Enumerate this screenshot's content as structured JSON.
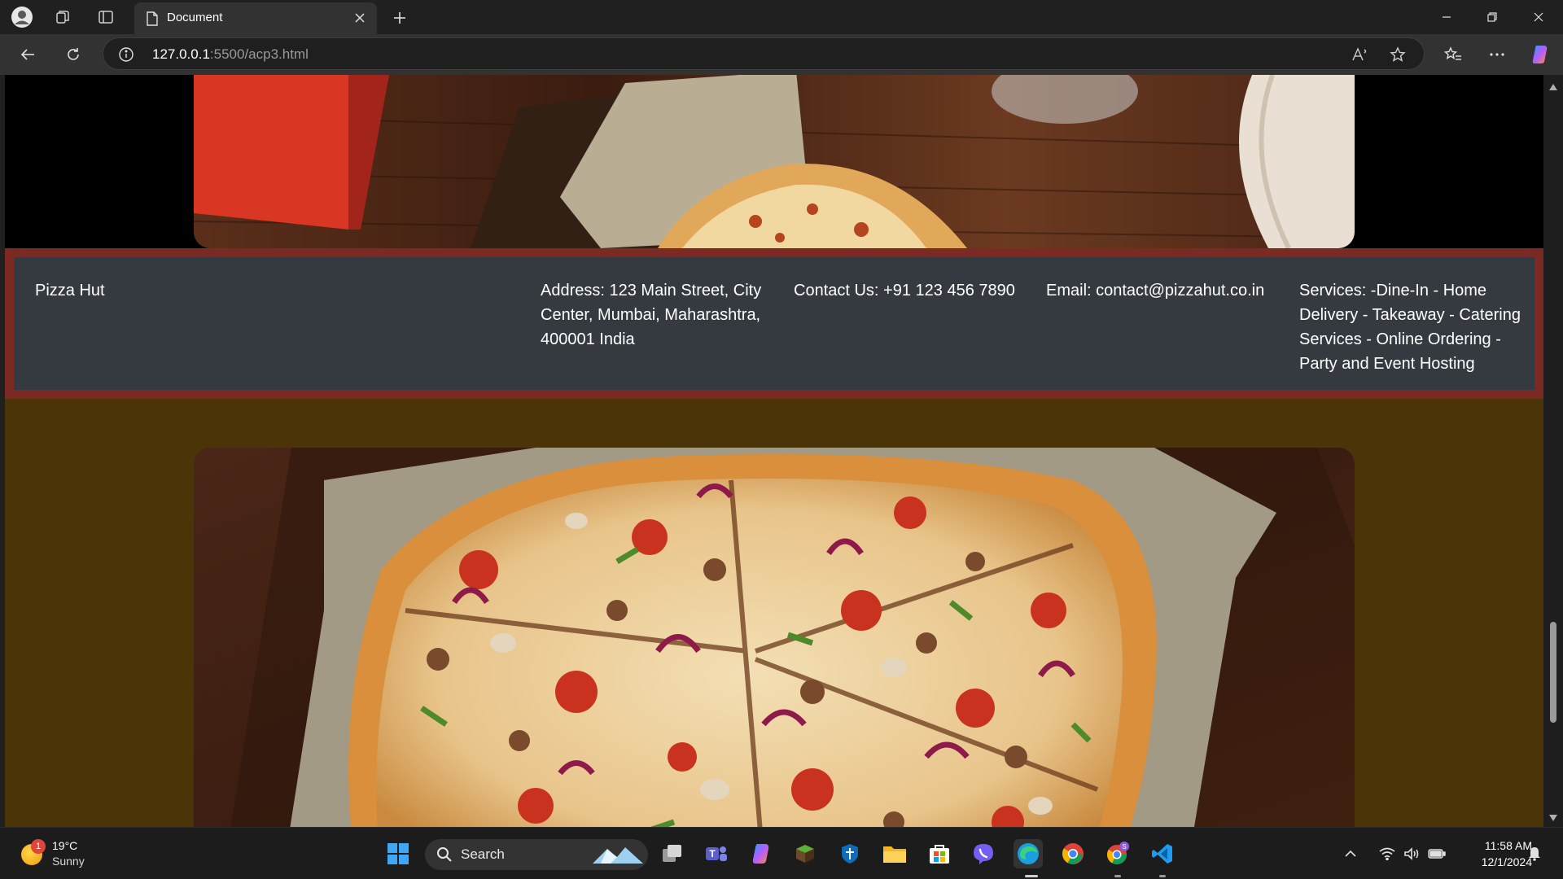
{
  "browser": {
    "tab_title": "Document",
    "url_host": "127.0.0.1",
    "url_rest": ":5500/acp3.html"
  },
  "footer": {
    "brand": "Pizza Hut",
    "address": "Address: 123 Main Street, City Center, Mumbai, Maharashtra, 400001 India",
    "contact": "Contact Us: +91 123 456 7890",
    "email": "Email: contact@pizzahut.co.in",
    "services": "Services: -Dine-In - Home Delivery - Takeaway - Catering Services - Online Ordering - Party and Event Hosting"
  },
  "taskbar": {
    "weather_temp": "19°C",
    "weather_condition": "Sunny",
    "weather_badge": "1",
    "search_label": "Search",
    "time": "11:58 AM",
    "date": "12/1/2024"
  },
  "colors": {
    "footer_border": "#7a2a22",
    "footer_bg": "#343a40",
    "bottom_section_bg": "#4b3408",
    "top_section_bg": "#000000"
  }
}
